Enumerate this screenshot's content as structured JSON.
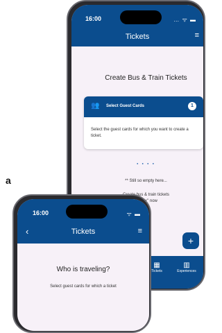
{
  "back_phone": {
    "status_time": "16:00",
    "status_icons": "…  ᯤ ▬",
    "app_title": "Tickets",
    "menu_icon": "≡",
    "heading": "Create Bus & Train Tickets",
    "card": {
      "title": "Select Guest Cards",
      "step": "1",
      "body": "Select the guest cards for which you want to create a ticket."
    },
    "pager": "● ● ● ●",
    "empty_text": "** Still so empty here...",
    "create_text": "Create bus & train tickets",
    "create_text2": "with \"+\" now",
    "fab": "+",
    "nav": [
      {
        "label": "Tickets",
        "icon": "▦"
      },
      {
        "label": "Experiences",
        "icon": "▥"
      }
    ]
  },
  "front_phone": {
    "status_time": "16:00",
    "status_icons": "ᯤ ▬",
    "app_title": "Tickets",
    "menu_icon": "≡",
    "back_icon": "‹",
    "heading": "Who is traveling?",
    "subtext": "Select guest cards for which a ticket"
  },
  "overlay_label": "a",
  "colors": {
    "primary": "#0b4d8e",
    "background": "#f7f1f8"
  }
}
